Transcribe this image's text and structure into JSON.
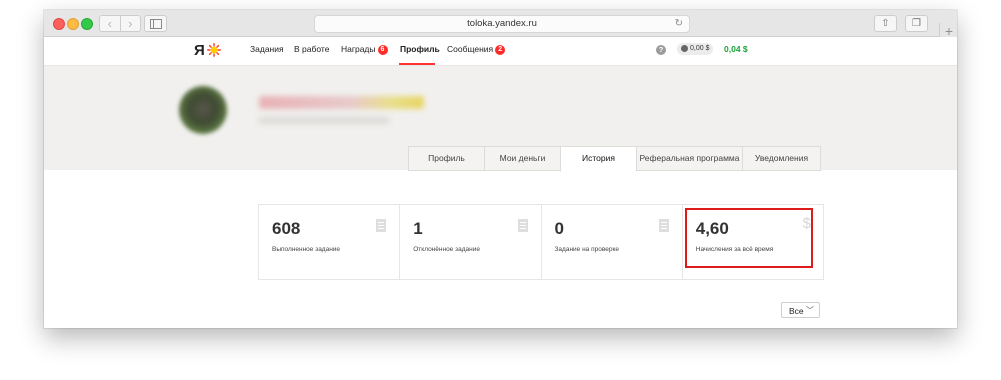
{
  "browser": {
    "url": "toloka.yandex.ru"
  },
  "site": {
    "logo_text": "Я",
    "nav": {
      "tasks": "Задания",
      "in_work": "В работе",
      "rewards": "Награды",
      "rewards_badge": "6",
      "profile": "Профиль",
      "messages": "Сообщения",
      "messages_badge": "2"
    },
    "help_label": "?",
    "balance_pill": "0,00 $",
    "balance_green": "0,04 $"
  },
  "profile": {
    "tabs": [
      "Профиль",
      "Мои деньги",
      "История",
      "Реферальная программа",
      "Уведомления"
    ],
    "active_tab_index": 2
  },
  "stats": [
    {
      "value": "608",
      "label": "Выполненное задание",
      "icon": "document-icon"
    },
    {
      "value": "1",
      "label": "Отклонённое задание",
      "icon": "document-icon"
    },
    {
      "value": "0",
      "label": "Задание на проверке",
      "icon": "document-icon"
    },
    {
      "value": "4,60",
      "label": "Начисления за всё время",
      "icon": "dollar-icon",
      "symbol": "$"
    }
  ],
  "filter": {
    "selected": "Все"
  },
  "colors": {
    "accent_red": "#dd1b1b",
    "badge_red": "#ff2b2b",
    "balance_green": "#1aa33a"
  }
}
